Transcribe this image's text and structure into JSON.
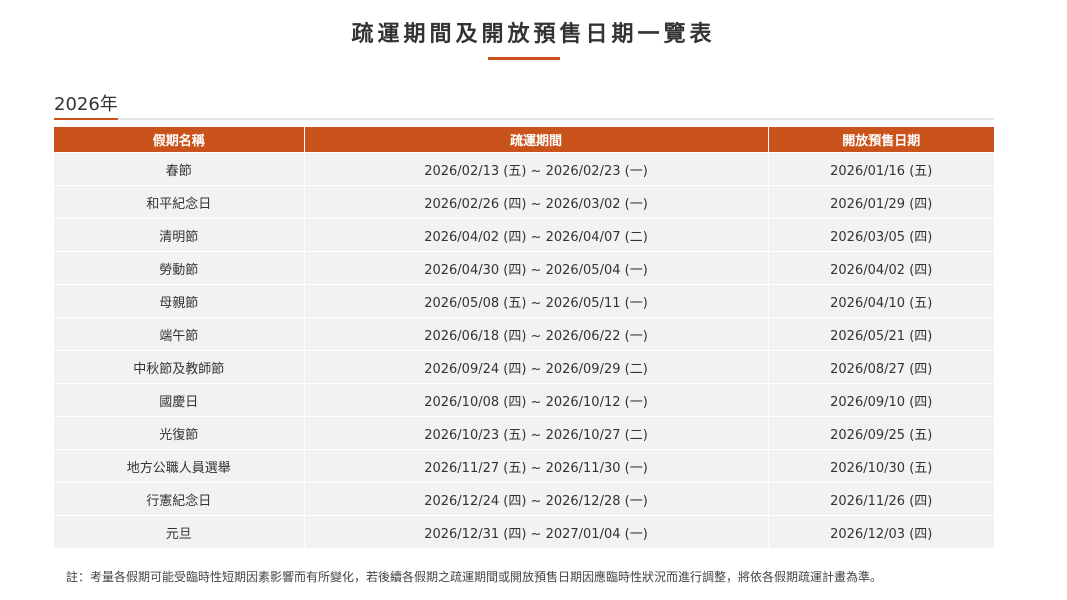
{
  "page": {
    "title": "疏運期間及開放預售日期一覽表",
    "year_label": "2026年",
    "note": "註：考量各假期可能受臨時性短期因素影響而有所變化，若後續各假期之疏運期間或開放預售日期因應臨時性狀況而進行調整，將依各假期疏運計畫為準。"
  },
  "colors": {
    "accent": "#c9531a",
    "row_background": "#f2f2f2",
    "text": "#333333"
  },
  "table": {
    "headers": [
      "假期名稱",
      "疏運期間",
      "開放預售日期"
    ],
    "rows": [
      {
        "holiday": "春節",
        "period": "2026/02/13 (五) ~ 2026/02/23 (一)",
        "presale": "2026/01/16 (五)"
      },
      {
        "holiday": "和平紀念日",
        "period": "2026/02/26 (四) ~ 2026/03/02 (一)",
        "presale": "2026/01/29 (四)"
      },
      {
        "holiday": "清明節",
        "period": "2026/04/02 (四) ~ 2026/04/07 (二)",
        "presale": "2026/03/05 (四)"
      },
      {
        "holiday": "勞動節",
        "period": "2026/04/30 (四) ~ 2026/05/04 (一)",
        "presale": "2026/04/02 (四)"
      },
      {
        "holiday": "母親節",
        "period": "2026/05/08 (五) ~ 2026/05/11 (一)",
        "presale": "2026/04/10 (五)"
      },
      {
        "holiday": "端午節",
        "period": "2026/06/18 (四) ~ 2026/06/22 (一)",
        "presale": "2026/05/21 (四)"
      },
      {
        "holiday": "中秋節及教師節",
        "period": "2026/09/24 (四) ~ 2026/09/29 (二)",
        "presale": "2026/08/27 (四)"
      },
      {
        "holiday": "國慶日",
        "period": "2026/10/08 (四) ~ 2026/10/12 (一)",
        "presale": "2026/09/10 (四)"
      },
      {
        "holiday": "光復節",
        "period": "2026/10/23 (五) ~ 2026/10/27 (二)",
        "presale": "2026/09/25 (五)"
      },
      {
        "holiday": "地方公職人員選舉",
        "period": "2026/11/27 (五) ~ 2026/11/30 (一)",
        "presale": "2026/10/30 (五)"
      },
      {
        "holiday": "行憲紀念日",
        "period": "2026/12/24 (四) ~ 2026/12/28 (一)",
        "presale": "2026/11/26 (四)"
      },
      {
        "holiday": "元旦",
        "period": "2026/12/31 (四) ~ 2027/01/04 (一)",
        "presale": "2026/12/03 (四)"
      }
    ]
  }
}
